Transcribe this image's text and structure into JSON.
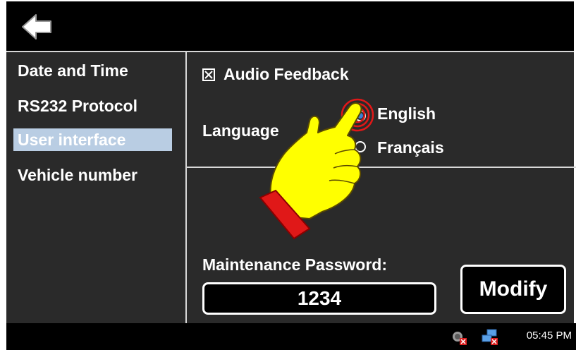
{
  "topbar": {
    "back_icon": "back-arrow-icon"
  },
  "sidebar": {
    "items": [
      {
        "label": "Date and Time",
        "selected": false
      },
      {
        "label": "RS232 Protocol",
        "selected": false
      },
      {
        "label": "User interface",
        "selected": true
      },
      {
        "label": "Vehicle number",
        "selected": false
      }
    ]
  },
  "main": {
    "audio_feedback": {
      "label": "Audio Feedback",
      "checked": true
    },
    "language": {
      "label": "Language",
      "options": [
        {
          "label": "English",
          "checked": true
        },
        {
          "label": "Français",
          "checked": false
        }
      ]
    },
    "password": {
      "label": "Maintenance Password:",
      "value": "1234"
    },
    "modify_label": "Modify"
  },
  "taskbar": {
    "clock": "05:45 PM",
    "icons": [
      "volume-muted-icon",
      "network-disconnected-icon"
    ]
  },
  "overlay": {
    "icon": "pointing-hand-cursor-icon"
  },
  "colors": {
    "panel_bg": "#2a2a2a",
    "bar_bg": "#000000",
    "selected_bg": "#b9cde3",
    "radio_accent": "#3b7fd6",
    "hand_fill": "#ffff00",
    "hand_cuff": "#e01818"
  }
}
